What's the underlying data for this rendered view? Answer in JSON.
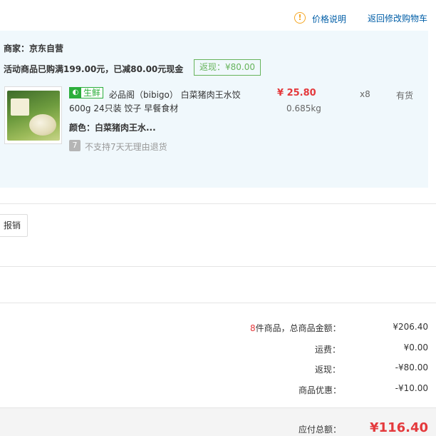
{
  "header": {
    "price_note_icon_glyph": "!",
    "price_note_label": "价格说明",
    "back_to_cart_label": "返回修改购物车"
  },
  "order": {
    "merchant_label": "商家：京东自营",
    "promo_text": "活动商品已购满199.00元，已减80.00元现金",
    "promo_badge": "返现：¥80.00",
    "item": {
      "fresh_badge_text": "生鲜",
      "title_line1": "必品阁（bibigo） 白菜猪肉王水饺",
      "title_line2": "600g 24只装 饺子 早餐食材",
      "color_text": "颜色：白菜猪肉王水...",
      "return_icon_glyph": "7",
      "return_policy": "不支持7天无理由退货",
      "price": "¥ 25.80",
      "weight": "0.685kg",
      "quantity": "x8",
      "stock_status": "有货"
    }
  },
  "invoice": {
    "button_label": "报销"
  },
  "summary": {
    "item_count": "8",
    "item_count_label": "件商品，总商品金额：",
    "total_goods_amount": "¥206.40",
    "shipping_label": "运费：",
    "shipping_value": "¥0.00",
    "cashback_label": "返现：",
    "cashback_value": "-¥80.00",
    "discount_label": "商品优惠：",
    "discount_value": "-¥10.00",
    "payable_label": "应付总额：",
    "payable_value": "¥116.40"
  },
  "colors": {
    "accent_red": "#e4393c",
    "link_blue": "#005ea7",
    "fresh_green": "#2bae3a",
    "panel_bg": "#f0f8fc"
  }
}
